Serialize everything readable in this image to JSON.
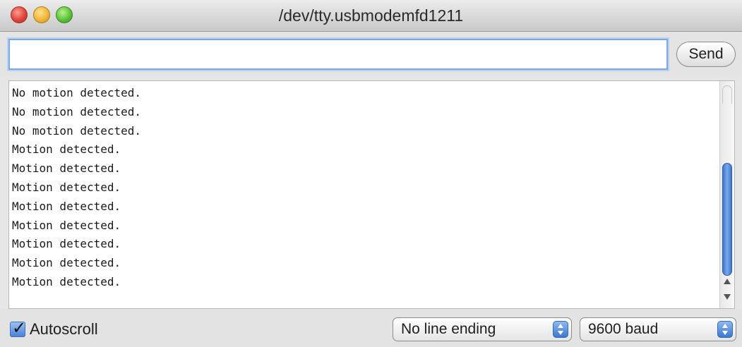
{
  "window": {
    "title": "/dev/tty.usbmodemfd1211"
  },
  "send": {
    "input_value": "",
    "button_label": "Send"
  },
  "output": {
    "lines": [
      "No motion detected.",
      "No motion detected.",
      "No motion detected.",
      "Motion detected.",
      "Motion detected.",
      "Motion detected.",
      "Motion detected.",
      "Motion detected.",
      "Motion detected.",
      "Motion detected.",
      "Motion detected."
    ]
  },
  "bottom": {
    "autoscroll_label": "Autoscroll",
    "autoscroll_checked": true,
    "line_ending_selected": "No line ending",
    "baud_selected": "9600 baud"
  },
  "colors": {
    "accent": "#4b82d6",
    "close": "#e0443a",
    "minimize": "#f2b63a",
    "maximize": "#5cc33a"
  },
  "icons": {
    "close": "close-icon",
    "minimize": "minimize-icon",
    "maximize": "maximize-icon",
    "checkmark": "checkmark-icon",
    "stepper": "updown-arrows-icon"
  }
}
